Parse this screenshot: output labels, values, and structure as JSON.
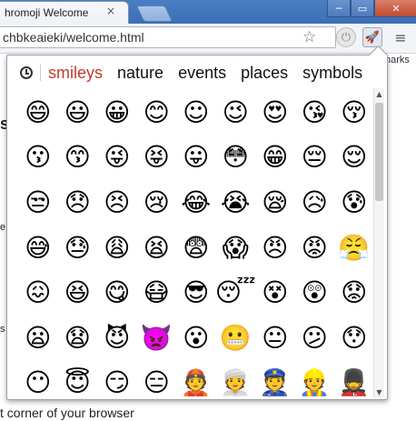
{
  "browser": {
    "tab_title": "hromoji Welcome",
    "tab_close": "×",
    "url": "chbkeaieki/welcome.html",
    "star_icon": "☆",
    "menu_icon": "≡",
    "min_glyph": "─",
    "max_glyph": "▭",
    "close_glyph": "✕",
    "bookmarks_fragment": "narks"
  },
  "page_fragments": {
    "heading_fragment": "s",
    "bottom_text": "t corner of your browser",
    "mark1": "e",
    "mark2": "s"
  },
  "popup": {
    "categories": [
      {
        "label": "smileys",
        "active": true
      },
      {
        "label": "nature",
        "active": false
      },
      {
        "label": "events",
        "active": false
      },
      {
        "label": "places",
        "active": false
      },
      {
        "label": "symbols",
        "active": false
      }
    ],
    "scroll_up": "▲",
    "scroll_down": "▼",
    "emojis": [
      "😄",
      "😃",
      "😀",
      "😊",
      "☺",
      "😉",
      "😍",
      "😘",
      "😚",
      "😗",
      "😙",
      "😜",
      "😝",
      "😛",
      "😳",
      "😁",
      "😔",
      "😌",
      "😒",
      "😞",
      "😣",
      "😢",
      "😂",
      "😭",
      "😪",
      "😥",
      "😰",
      "😅",
      "😓",
      "😩",
      "😫",
      "😨",
      "😱",
      "😠",
      "😡",
      "😤",
      "😖",
      "😆",
      "😋",
      "😷",
      "😎",
      "😴",
      "😵",
      "😲",
      "😟",
      "😦",
      "😧",
      "😈",
      "👿",
      "😮",
      "😬",
      "😐",
      "😕",
      "😯",
      "😶",
      "😇",
      "😏",
      "😑",
      "👲",
      "👳",
      "👮",
      "👷",
      "💂"
    ]
  },
  "colors": {
    "active_category": "#c0392b",
    "tabstrip": "#3b6fb6"
  }
}
